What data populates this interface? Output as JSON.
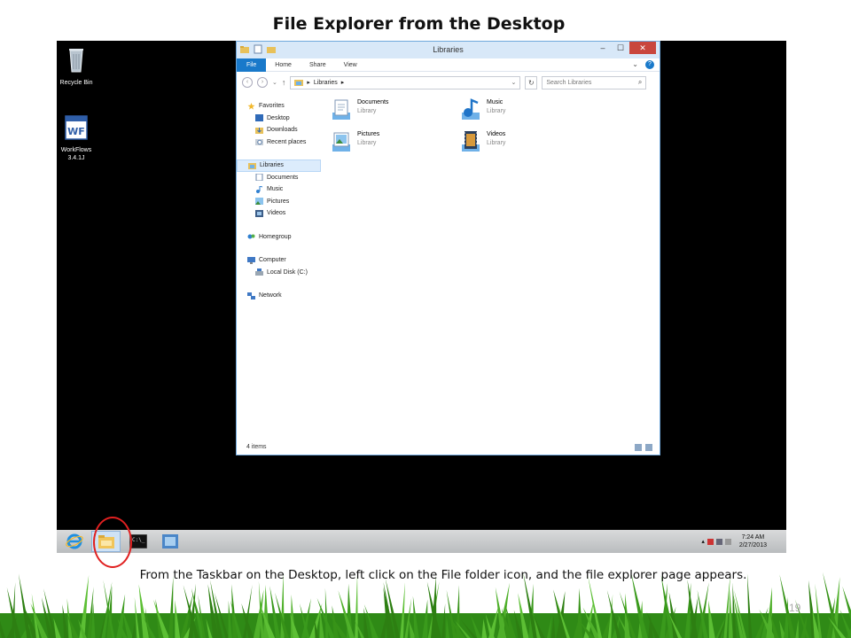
{
  "slide": {
    "title": "File Explorer from  the Desktop",
    "caption": "From the Taskbar on the Desktop,  left click on the File folder icon, and the file explorer page appears.",
    "page_number": "19"
  },
  "desktop": {
    "icons": [
      {
        "label": "Recycle Bin",
        "icon": "recycle-bin-icon"
      },
      {
        "label": "WorkFlows\n3.4.1J",
        "icon": "workflows-icon"
      }
    ]
  },
  "explorer": {
    "title": "Libraries",
    "window_buttons": {
      "minimize": "–",
      "maximize": "☐",
      "close": "✕"
    },
    "ribbon": {
      "tabs": [
        "File",
        "Home",
        "Share",
        "View"
      ],
      "expand": "⌄",
      "help": "?"
    },
    "navbar": {
      "back": "‹",
      "forward": "›",
      "recent": "⌄",
      "up": "↑",
      "address_path": "Libraries",
      "address_arrow": "▸",
      "address_dropdown": "⌄",
      "refresh": "↻",
      "search_placeholder": "Search Libraries",
      "search_icon": "⌕"
    },
    "nav_pane": {
      "favorites": "Favorites",
      "favorite_items": [
        "Desktop",
        "Downloads",
        "Recent places"
      ],
      "libraries": "Libraries",
      "library_items": [
        "Documents",
        "Music",
        "Pictures",
        "Videos"
      ],
      "homegroup": "Homegroup",
      "computer": "Computer",
      "computer_items": [
        "Local Disk (C:)"
      ],
      "network": "Network"
    },
    "content": {
      "libraries": [
        {
          "name": "Documents",
          "type": "Library"
        },
        {
          "name": "Music",
          "type": "Library"
        },
        {
          "name": "Pictures",
          "type": "Library"
        },
        {
          "name": "Videos",
          "type": "Library"
        }
      ]
    },
    "status": "4 items"
  },
  "taskbar": {
    "buttons": [
      "internet-explorer-icon",
      "file-explorer-icon",
      "command-prompt-icon",
      "server-manager-icon"
    ],
    "tray_expander": "▴",
    "time": "7:24 AM",
    "date": "2/27/2013"
  },
  "colors": {
    "annotation_circle": "#e02020",
    "ribbon_file_tab": "#1979ca",
    "desktop_background": "#000000",
    "grass": "#3a9a1c"
  }
}
